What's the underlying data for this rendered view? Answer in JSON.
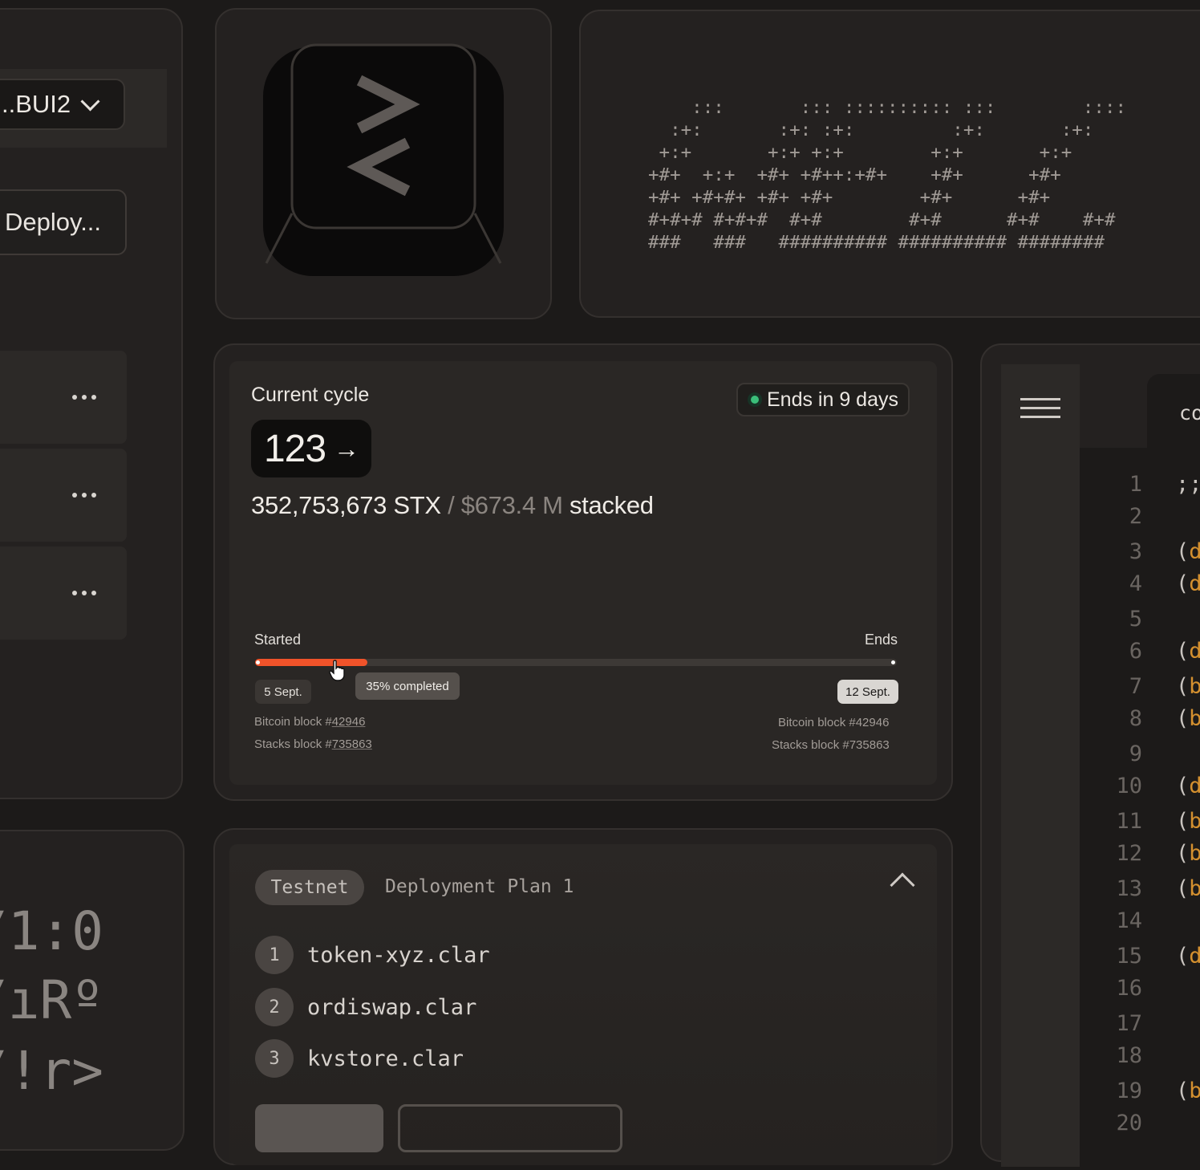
{
  "sidebar": {
    "address_short": "..BUI2",
    "deploy_label": "Deploy...",
    "rows": [
      {
        "menu_icon": "more-horizontal-icon"
      },
      {
        "menu_icon": "more-horizontal-icon"
      },
      {
        "menu_icon": "more-horizontal-icon"
      }
    ]
  },
  "glyph_preview": {
    "lines": [
      "/1:0",
      "/ıRº",
      "/!r>"
    ]
  },
  "logo": {
    "icon": "keycap-logo-icon"
  },
  "ascii_art": {
    "text": "    :::       ::: :::::::::: :::        ::::\n  :+:       :+: :+:         :+:       :+:\n +:+       +:+ +:+        +:+       +:+\n+#+  +:+  +#+ +#++:+#+    +#+      +#+\n+#+ +#+#+ +#+ +#+        +#+      +#+\n#+#+# #+#+#  #+#        #+#      #+#    #+#\n###   ###   ########## ########## ########"
  },
  "cycle": {
    "label": "Current cycle",
    "number": "123",
    "arrow": "→",
    "ends_badge": "Ends in 9 days",
    "stacked_amount": "352,753,673 STX",
    "stacked_sep": "/",
    "stacked_usd": "$673.4 M",
    "stacked_suffix": "stacked",
    "started_label": "Started",
    "ends_label": "Ends",
    "progress_percent": 35,
    "progress_label": "35% completed",
    "start_date": "5 Sept.",
    "end_date": "12 Sept.",
    "start_bitcoin_prefix": "Bitcoin block #",
    "start_bitcoin_block": "42946",
    "start_stacks_prefix": "Stacks block #",
    "start_stacks_block": "735863",
    "end_bitcoin": "Bitcoin block #42946",
    "end_stacks": "Stacks block #735863",
    "accent_color": "#f0532a"
  },
  "deployment": {
    "network": "Testnet",
    "title": "Deployment Plan 1",
    "items": [
      {
        "num": "1",
        "name": "token-xyz.clar"
      },
      {
        "num": "2",
        "name": "ordiswap.clar"
      },
      {
        "num": "3",
        "name": "kvstore.clar"
      }
    ]
  },
  "editor": {
    "tab_label": "co",
    "menu_icon": "hamburger-menu-icon",
    "line_numbers": [
      "1",
      "2",
      "3",
      "4",
      "5",
      "6",
      "7",
      "8",
      "9",
      "10",
      "11",
      "12",
      "13",
      "14",
      "15",
      "16",
      "17",
      "18",
      "19",
      "20"
    ],
    "code_lines": [
      {
        "line": "1",
        "text": ";;"
      },
      {
        "line": "3",
        "paren": "(",
        "kw": "d"
      },
      {
        "line": "4",
        "paren": "(",
        "kw": "d"
      },
      {
        "line": "6",
        "paren": "(",
        "kw": "d"
      },
      {
        "line": "7",
        "paren": "(",
        "kw": "b"
      },
      {
        "line": "8",
        "paren": "(",
        "kw": "b"
      },
      {
        "line": "10",
        "paren": "(",
        "kw": "d"
      },
      {
        "line": "11",
        "paren": "(",
        "kw": "b"
      },
      {
        "line": "12",
        "paren": "(",
        "kw": "b"
      },
      {
        "line": "13",
        "paren": "(",
        "kw": "b"
      },
      {
        "line": "15",
        "paren": "(",
        "kw": "d"
      },
      {
        "line": "19",
        "paren": "(",
        "kw": "b"
      }
    ]
  }
}
